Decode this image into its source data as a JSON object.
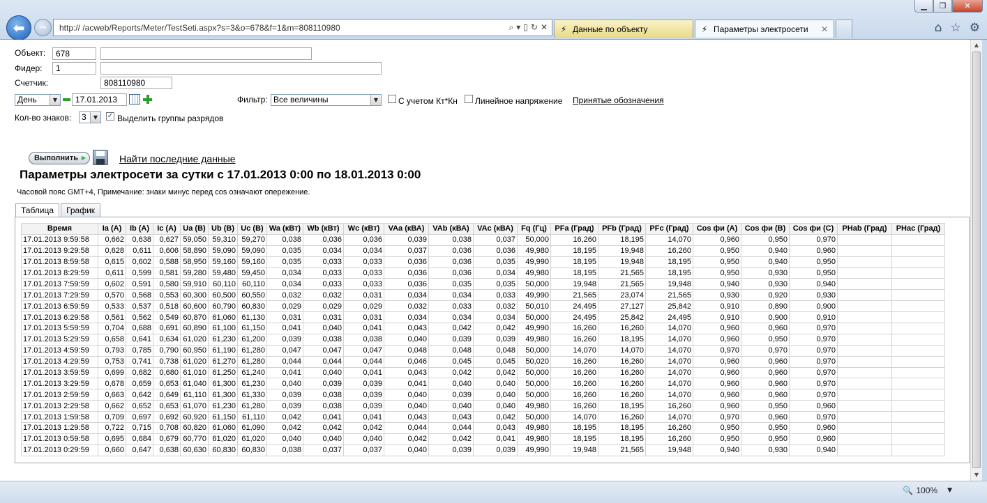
{
  "browser": {
    "address": "http://            /acweb/Reports/Meter/TestSeti.aspx?s=3&o=678&f=1&m=808110980",
    "tabs": [
      {
        "label": "Данные по объекту"
      },
      {
        "label": "Параметры электросети"
      }
    ],
    "zoom": "100%"
  },
  "form": {
    "object_label": "Объект:",
    "object_id": "678",
    "object_name": "",
    "feeder_label": "Фидер:",
    "feeder_id": "1",
    "feeder_name": "",
    "meter_label": "Счетчик:",
    "meter_id": "808110980",
    "period": "День",
    "date": "17.01.2013",
    "filter_label": "Фильтр:",
    "filter_value": "Все величины",
    "kt_label": "С учетом Кт*Кн",
    "line_voltage_label": "Линейное напряжение",
    "legend_link": "Принятые обозначения",
    "digits_label": "Кол-во знаков:",
    "digits_value": "3",
    "group_digits_label": "Выделить группы разрядов",
    "run_button": "Выполнить",
    "last_data_link": "Найти последние данные"
  },
  "report": {
    "title": "Параметры электросети за сутки с 17.01.2013 0:00 по 18.01.2013 0:00",
    "note": "Часовой пояс GMT+4, Примечание: знаки минус перед cos означают опережение.",
    "tabs": [
      "Таблица",
      "График"
    ]
  },
  "table": {
    "headers": [
      "Время",
      "Ia (A)",
      "Ib (A)",
      "Ic (A)",
      "Ua (B)",
      "Ub (B)",
      "Uc (B)",
      "Wa (кВт)",
      "Wb (кВт)",
      "Wc (кВт)",
      "VAa (кВА)",
      "VAb (кВА)",
      "VAc (кВА)",
      "Fq (Гц)",
      "PFa (Град)",
      "PFb (Град)",
      "PFc (Град)",
      "Cos фи (A)",
      "Cos фи (B)",
      "Cos фи (C)",
      "PHab (Град)",
      "PHac (Град)"
    ],
    "rows": [
      [
        "17.01.2013 9:59:58",
        "0,662",
        "0,638",
        "0,627",
        "59,050",
        "59,310",
        "59,270",
        "0,038",
        "0,036",
        "0,036",
        "0,039",
        "0,038",
        "0,037",
        "50,000",
        "16,260",
        "18,195",
        "14,070",
        "0,960",
        "0,950",
        "0,970",
        "",
        ""
      ],
      [
        "17.01.2013 9:29:58",
        "0,628",
        "0,611",
        "0,606",
        "58,890",
        "59,090",
        "59,090",
        "0,035",
        "0,034",
        "0,034",
        "0,037",
        "0,036",
        "0,036",
        "49,980",
        "18,195",
        "19,948",
        "16,260",
        "0,950",
        "0,940",
        "0,960",
        "",
        ""
      ],
      [
        "17.01.2013 8:59:58",
        "0,615",
        "0,602",
        "0,588",
        "58,950",
        "59,160",
        "59,160",
        "0,035",
        "0,033",
        "0,033",
        "0,036",
        "0,036",
        "0,035",
        "49,990",
        "18,195",
        "19,948",
        "18,195",
        "0,950",
        "0,940",
        "0,950",
        "",
        ""
      ],
      [
        "17.01.2013 8:29:59",
        "0,611",
        "0,599",
        "0,581",
        "59,280",
        "59,480",
        "59,450",
        "0,034",
        "0,033",
        "0,033",
        "0,036",
        "0,036",
        "0,034",
        "49,980",
        "18,195",
        "21,565",
        "18,195",
        "0,950",
        "0,930",
        "0,950",
        "",
        ""
      ],
      [
        "17.01.2013 7:59:59",
        "0,602",
        "0,591",
        "0,580",
        "59,910",
        "60,110",
        "60,110",
        "0,034",
        "0,033",
        "0,033",
        "0,036",
        "0,035",
        "0,035",
        "50,000",
        "19,948",
        "21,565",
        "19,948",
        "0,940",
        "0,930",
        "0,940",
        "",
        ""
      ],
      [
        "17.01.2013 7:29:59",
        "0,570",
        "0,568",
        "0,553",
        "60,300",
        "60,500",
        "60,550",
        "0,032",
        "0,032",
        "0,031",
        "0,034",
        "0,034",
        "0,033",
        "49,990",
        "21,565",
        "23,074",
        "21,565",
        "0,930",
        "0,920",
        "0,930",
        "",
        ""
      ],
      [
        "17.01.2013 6:59:59",
        "0,533",
        "0,537",
        "0,518",
        "60,600",
        "60,790",
        "60,830",
        "0,029",
        "0,029",
        "0,029",
        "0,032",
        "0,033",
        "0,032",
        "50,010",
        "24,495",
        "27,127",
        "25,842",
        "0,910",
        "0,890",
        "0,900",
        "",
        ""
      ],
      [
        "17.01.2013 6:29:58",
        "0,561",
        "0,562",
        "0,549",
        "60,870",
        "61,060",
        "61,130",
        "0,031",
        "0,031",
        "0,031",
        "0,034",
        "0,034",
        "0,034",
        "50,000",
        "24,495",
        "25,842",
        "24,495",
        "0,910",
        "0,900",
        "0,910",
        "",
        ""
      ],
      [
        "17.01.2013 5:59:59",
        "0,704",
        "0,688",
        "0,691",
        "60,890",
        "61,100",
        "61,150",
        "0,041",
        "0,040",
        "0,041",
        "0,043",
        "0,042",
        "0,042",
        "49,990",
        "16,260",
        "16,260",
        "14,070",
        "0,960",
        "0,960",
        "0,970",
        "",
        ""
      ],
      [
        "17.01.2013 5:29:59",
        "0,658",
        "0,641",
        "0,634",
        "61,020",
        "61,230",
        "61,200",
        "0,039",
        "0,038",
        "0,038",
        "0,040",
        "0,039",
        "0,039",
        "49,980",
        "16,260",
        "18,195",
        "14,070",
        "0,960",
        "0,950",
        "0,970",
        "",
        ""
      ],
      [
        "17.01.2013 4:59:59",
        "0,793",
        "0,785",
        "0,790",
        "60,950",
        "61,190",
        "61,280",
        "0,047",
        "0,047",
        "0,047",
        "0,048",
        "0,048",
        "0,048",
        "50,000",
        "14,070",
        "14,070",
        "14,070",
        "0,970",
        "0,970",
        "0,970",
        "",
        ""
      ],
      [
        "17.01.2013 4:29:59",
        "0,753",
        "0,741",
        "0,738",
        "61,020",
        "61,270",
        "61,280",
        "0,044",
        "0,044",
        "0,044",
        "0,046",
        "0,045",
        "0,045",
        "50,020",
        "16,260",
        "16,260",
        "14,070",
        "0,960",
        "0,960",
        "0,970",
        "",
        ""
      ],
      [
        "17.01.2013 3:59:59",
        "0,699",
        "0,682",
        "0,680",
        "61,010",
        "61,250",
        "61,240",
        "0,041",
        "0,040",
        "0,041",
        "0,043",
        "0,042",
        "0,042",
        "50,000",
        "16,260",
        "16,260",
        "14,070",
        "0,960",
        "0,960",
        "0,970",
        "",
        ""
      ],
      [
        "17.01.2013 3:29:59",
        "0,678",
        "0,659",
        "0,653",
        "61,040",
        "61,300",
        "61,230",
        "0,040",
        "0,039",
        "0,039",
        "0,041",
        "0,040",
        "0,040",
        "50,000",
        "16,260",
        "16,260",
        "14,070",
        "0,960",
        "0,960",
        "0,970",
        "",
        ""
      ],
      [
        "17.01.2013 2:59:59",
        "0,663",
        "0,642",
        "0,649",
        "61,110",
        "61,300",
        "61,330",
        "0,039",
        "0,038",
        "0,039",
        "0,040",
        "0,039",
        "0,040",
        "50,000",
        "16,260",
        "16,260",
        "14,070",
        "0,960",
        "0,960",
        "0,970",
        "",
        ""
      ],
      [
        "17.01.2013 2:29:58",
        "0,662",
        "0,652",
        "0,653",
        "61,070",
        "61,230",
        "61,280",
        "0,039",
        "0,038",
        "0,039",
        "0,040",
        "0,040",
        "0,040",
        "49,980",
        "16,260",
        "18,195",
        "16,260",
        "0,960",
        "0,950",
        "0,960",
        "",
        ""
      ],
      [
        "17.01.2013 1:59:58",
        "0,709",
        "0,697",
        "0,692",
        "60,920",
        "61,150",
        "61,110",
        "0,042",
        "0,041",
        "0,041",
        "0,043",
        "0,043",
        "0,042",
        "50,000",
        "14,070",
        "16,260",
        "14,070",
        "0,970",
        "0,960",
        "0,970",
        "",
        ""
      ],
      [
        "17.01.2013 1:29:58",
        "0,722",
        "0,715",
        "0,708",
        "60,820",
        "61,060",
        "61,090",
        "0,042",
        "0,042",
        "0,042",
        "0,044",
        "0,044",
        "0,043",
        "49,980",
        "18,195",
        "18,195",
        "16,260",
        "0,950",
        "0,950",
        "0,960",
        "",
        ""
      ],
      [
        "17.01.2013 0:59:58",
        "0,695",
        "0,684",
        "0,679",
        "60,770",
        "61,020",
        "61,020",
        "0,040",
        "0,040",
        "0,040",
        "0,042",
        "0,042",
        "0,041",
        "49,980",
        "18,195",
        "18,195",
        "16,260",
        "0,950",
        "0,950",
        "0,960",
        "",
        ""
      ],
      [
        "17.01.2013 0:29:59",
        "0,660",
        "0,647",
        "0,638",
        "60,630",
        "60,830",
        "60,830",
        "0,038",
        "0,037",
        "0,037",
        "0,040",
        "0,039",
        "0,039",
        "49,990",
        "19,948",
        "21,565",
        "19,948",
        "0,940",
        "0,930",
        "0,940",
        "",
        ""
      ]
    ]
  },
  "colors": {
    "accent": "#1d5fb3",
    "active_tab": "#e9d98a",
    "green_control": "#2aa02a"
  }
}
